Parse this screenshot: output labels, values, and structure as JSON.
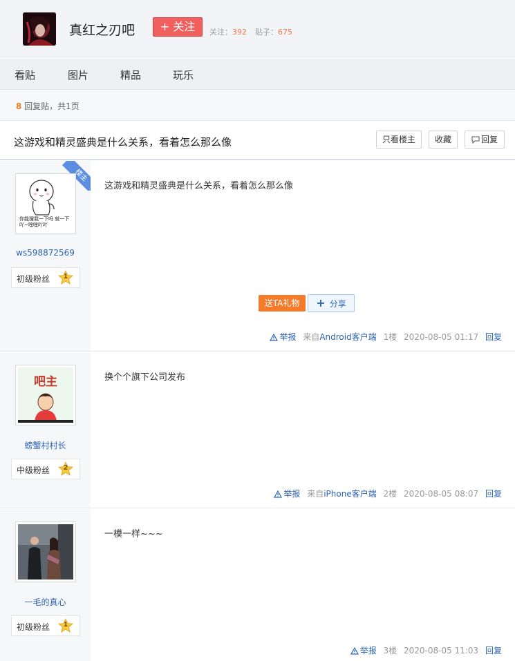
{
  "forum": {
    "name": "真红之刃吧",
    "follow_label": "+ 关注",
    "follow_count_label": "关注：",
    "follow_count": "392",
    "post_count_label": "贴子：",
    "post_count": "675"
  },
  "nav": {
    "tabs": [
      "看贴",
      "图片",
      "精品",
      "玩乐"
    ]
  },
  "reply_bar": {
    "count": "8",
    "text": " 回复贴，共1页"
  },
  "thread": {
    "title": "这游戏和精灵盛典是什么关系，看着怎么那么像",
    "only_op_label": "只看楼主",
    "favorite_label": "收藏",
    "reply_label": "回复"
  },
  "posts": [
    {
      "username": "ws598872569",
      "level_name": "初级粉丝",
      "level": "1",
      "op_badge": "楼主",
      "avatar_text": "你能搜我一下吗 就一下吖~嘿嘿吖吖",
      "content": "这游戏和精灵盛典是什么关系，看着怎么那么像",
      "gift_label": "送TA礼物",
      "share_label": "分享",
      "report_label": "举报",
      "client_prefix": "来自",
      "client": "Android客户端",
      "floor": "1楼",
      "time": "2020-08-05 01:17",
      "reply_label": "回复"
    },
    {
      "username": "螃蟹村村长",
      "level_name": "中级粉丝",
      "level": "2",
      "avatar_text": "吧主",
      "content": "换个个旗下公司发布",
      "report_label": "举报",
      "client_prefix": "来自",
      "client": "iPhone客户端",
      "floor": "2楼",
      "time": "2020-08-05 08:07",
      "reply_label": "回复"
    },
    {
      "username": "一毛的真心",
      "level_name": "初级粉丝",
      "level": "1",
      "content": "一模一样~~~",
      "report_label": "举报",
      "floor": "3楼",
      "time": "2020-08-05 11:03",
      "reply_label": "回复"
    }
  ],
  "colors": {
    "accent_red": "#f25f5f",
    "link_blue": "#2d64b3",
    "orange": "#f47b2a"
  }
}
